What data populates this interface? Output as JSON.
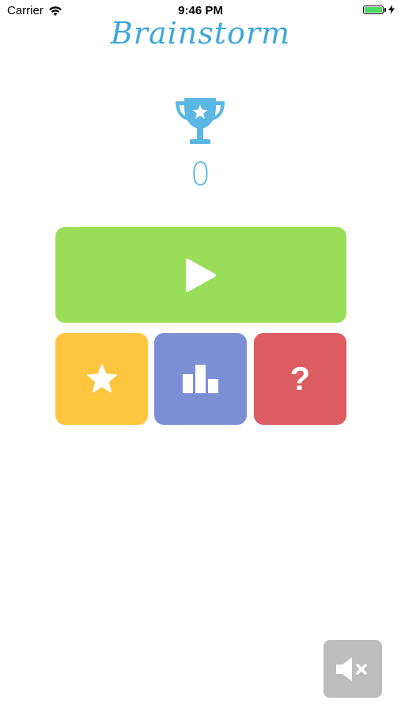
{
  "status_bar": {
    "carrier": "Carrier",
    "time": "9:46 PM",
    "battery_level": 1.0,
    "charging": true,
    "battery_color": "#4cd964"
  },
  "app": {
    "logo_text": "Brainstorm",
    "logo_color": "#3da8d8"
  },
  "score": {
    "icon": "trophy-icon",
    "value": "0",
    "color": "#5ab7e4"
  },
  "buttons": {
    "play": {
      "icon": "play-icon",
      "color": "#99dd58"
    },
    "favorites": {
      "icon": "star-icon",
      "color": "#ffc53e"
    },
    "leaderboard": {
      "icon": "bar-chart-icon",
      "color": "#7d8fd4"
    },
    "help": {
      "glyph": "?",
      "color": "#dc5c62"
    },
    "mute": {
      "icon": "speaker-muted-icon",
      "color": "#bdbdbd"
    }
  }
}
